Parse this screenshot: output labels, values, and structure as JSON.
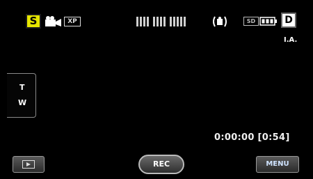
{
  "status_bar": {
    "mode_badge": "S",
    "quality_badge": "XP",
    "card_label": "SD",
    "dropbox_badge": "D",
    "scene_mode": "I.A."
  },
  "zoom": {
    "tele_label": "T",
    "wide_label": "W"
  },
  "recording": {
    "counter": "0:00:00 [0:54]"
  },
  "bottom_bar": {
    "rec_label": "REC",
    "menu_label": "MENU"
  },
  "icons": {
    "movie_mode": "camcorder-icon",
    "remaining": "remaining-time-bars-icon",
    "stabilizer": "image-stabilizer-icon",
    "battery": "battery-icon",
    "playback": "playback-icon"
  },
  "colors": {
    "mode_badge_bg": "#e6e600",
    "menu_text": "#cfe3ff"
  }
}
